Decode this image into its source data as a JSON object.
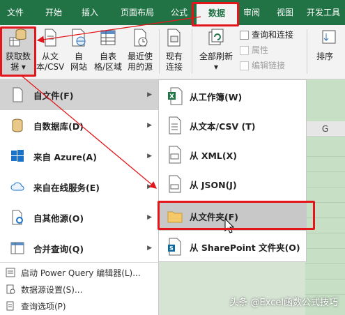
{
  "tabs": [
    {
      "label": "文件",
      "active": false
    },
    {
      "label": "开始",
      "active": false
    },
    {
      "label": "插入",
      "active": false
    },
    {
      "label": "页面布局",
      "active": false
    },
    {
      "label": "公式",
      "active": false
    },
    {
      "label": "数据",
      "active": true
    },
    {
      "label": "审阅",
      "active": false
    },
    {
      "label": "视图",
      "active": false
    },
    {
      "label": "开发工具",
      "active": false
    }
  ],
  "ribbon": {
    "get_data": {
      "line1": "获取数",
      "line2": "据 ▾"
    },
    "from_text": {
      "line1": "从文",
      "line2": "本/CSV"
    },
    "from_web": {
      "line1": "自",
      "line2": "网站"
    },
    "from_table": {
      "line1": "自表",
      "line2": "格/区域"
    },
    "recent": {
      "line1": "最近使",
      "line2": "用的源"
    },
    "existing": {
      "line1": "现有",
      "line2": "连接"
    },
    "refresh_all": {
      "line1": "全部刷新",
      "line2": "▾"
    },
    "queries": "查询和连接",
    "properties": "属性",
    "edit_links": "编辑链接",
    "sort": "排序"
  },
  "grid": {
    "col_header": "G"
  },
  "menu": {
    "items": [
      {
        "label": "自文件(F)",
        "icon": "file-icon",
        "has_submenu": true,
        "selected": true
      },
      {
        "label": "自数据库(D)",
        "icon": "database-icon",
        "has_submenu": true,
        "selected": false
      },
      {
        "label": "来自 Azure(A)",
        "icon": "windows-icon",
        "has_submenu": true,
        "selected": false
      },
      {
        "label": "来自在线服务(E)",
        "icon": "cloud-icon",
        "has_submenu": true,
        "selected": false
      },
      {
        "label": "自其他源(O)",
        "icon": "other-source-icon",
        "has_submenu": true,
        "selected": false
      },
      {
        "label": "合并查询(Q)",
        "icon": "merge-icon",
        "has_submenu": true,
        "selected": false
      }
    ],
    "small": [
      {
        "label": "启动 Power Query 编辑器(L)...",
        "icon": "power-query-icon"
      },
      {
        "label": "数据源设置(S)...",
        "icon": "settings-icon"
      },
      {
        "label": "查询选项(P)",
        "icon": "options-icon"
      }
    ]
  },
  "submenu": {
    "items": [
      {
        "label": "从工作簿(W)",
        "icon": "excel-workbook-icon",
        "selected": false
      },
      {
        "label": "从文本/CSV (T)",
        "icon": "text-file-icon",
        "selected": false
      },
      {
        "label": "从 XML(X)",
        "icon": "xml-file-icon",
        "selected": false
      },
      {
        "label": "从 JSON(J)",
        "icon": "json-file-icon",
        "selected": false
      },
      {
        "label": "从文件夹(F)",
        "icon": "folder-icon",
        "selected": true
      },
      {
        "label": "从 SharePoint 文件夹(O)",
        "icon": "sharepoint-icon",
        "selected": false
      }
    ]
  },
  "watermark": "头条 @Excel函数公式技巧",
  "colors": {
    "excel_green": "#217346",
    "highlight_red": "#e3171b",
    "selection_gray": "#c8c8c8"
  }
}
